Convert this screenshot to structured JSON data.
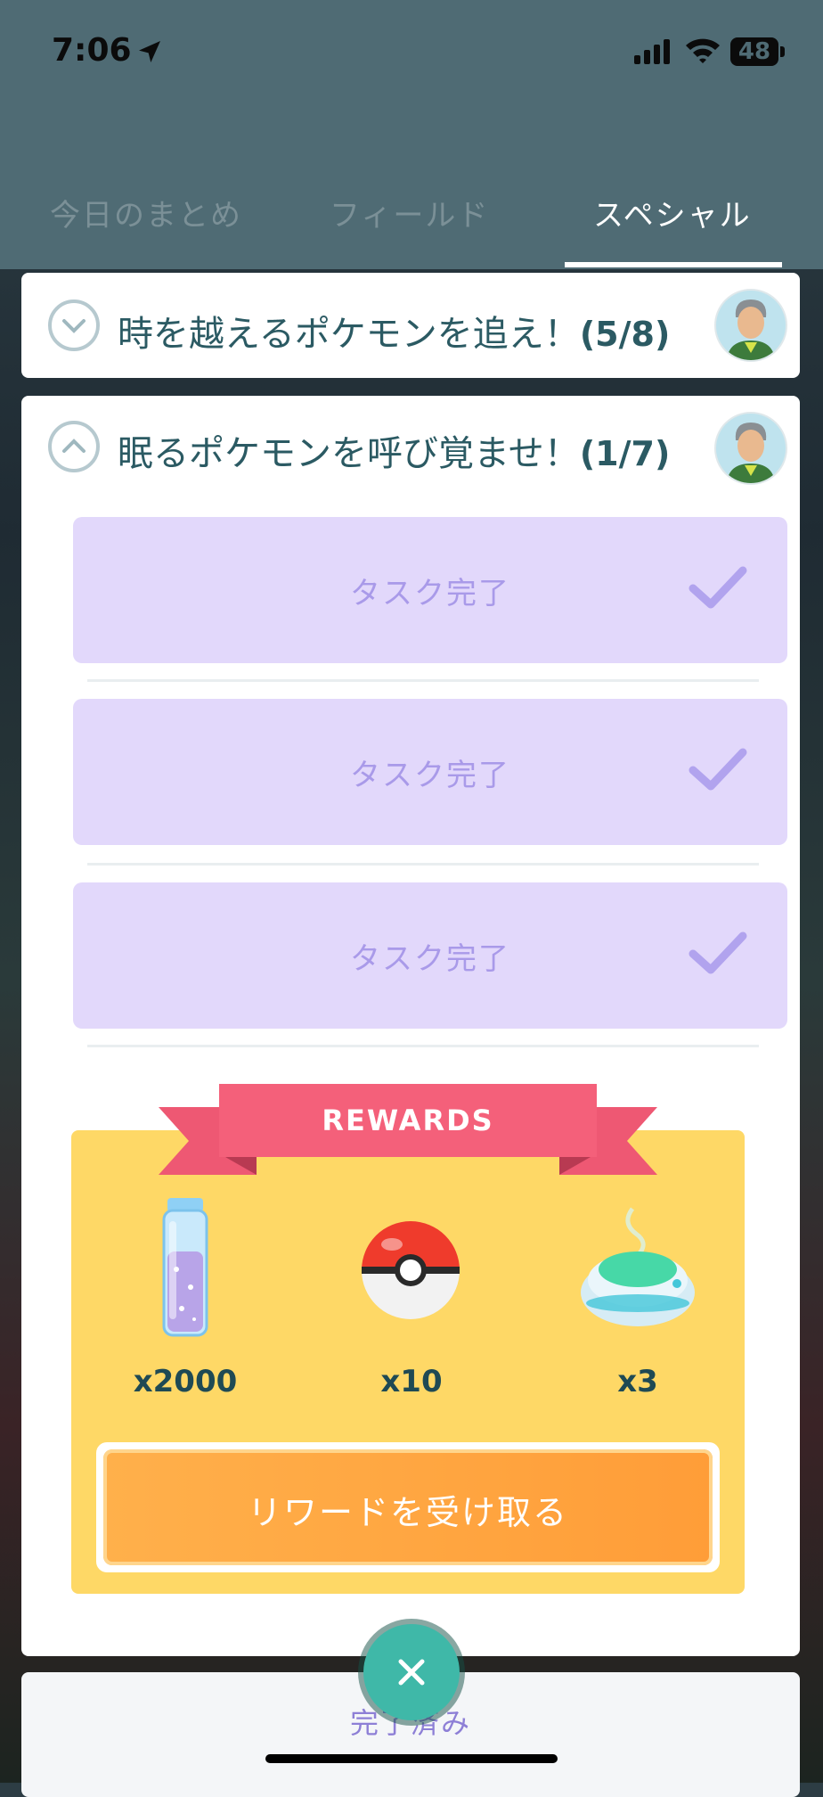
{
  "status_bar": {
    "time": "7:06",
    "battery": "48",
    "icons": [
      "location-arrow-icon",
      "signal-icon",
      "wifi-icon",
      "battery-icon"
    ]
  },
  "tabs": [
    {
      "label": "今日のまとめ",
      "active": false
    },
    {
      "label": "フィールド",
      "active": false
    },
    {
      "label": "スペシャル",
      "active": true
    }
  ],
  "quests": [
    {
      "title": "時を越えるポケモンを追え！",
      "progress": "(5/8)",
      "expanded": false
    },
    {
      "title": "眠るポケモンを呼び覚ませ！",
      "progress": "(1/7)",
      "expanded": true
    }
  ],
  "tasks": [
    {
      "label": "タスク完了",
      "completed": true
    },
    {
      "label": "タスク完了",
      "completed": true
    },
    {
      "label": "タスク完了",
      "completed": true
    }
  ],
  "rewards": {
    "banner": "REWARDS",
    "items": [
      {
        "icon": "stardust-icon",
        "quantity": "x2000"
      },
      {
        "icon": "poke-ball-icon",
        "quantity": "x10"
      },
      {
        "icon": "incense-icon",
        "quantity": "x3"
      }
    ],
    "claim_label": "リワードを受け取る"
  },
  "completed_section": {
    "label": "完了済み"
  },
  "colors": {
    "accent_teal": "#3fb8a8",
    "task_bg": "#e2d8fb",
    "rewards_bg": "#fed866",
    "ribbon": "#f4607a",
    "claim": "#ffa640"
  }
}
